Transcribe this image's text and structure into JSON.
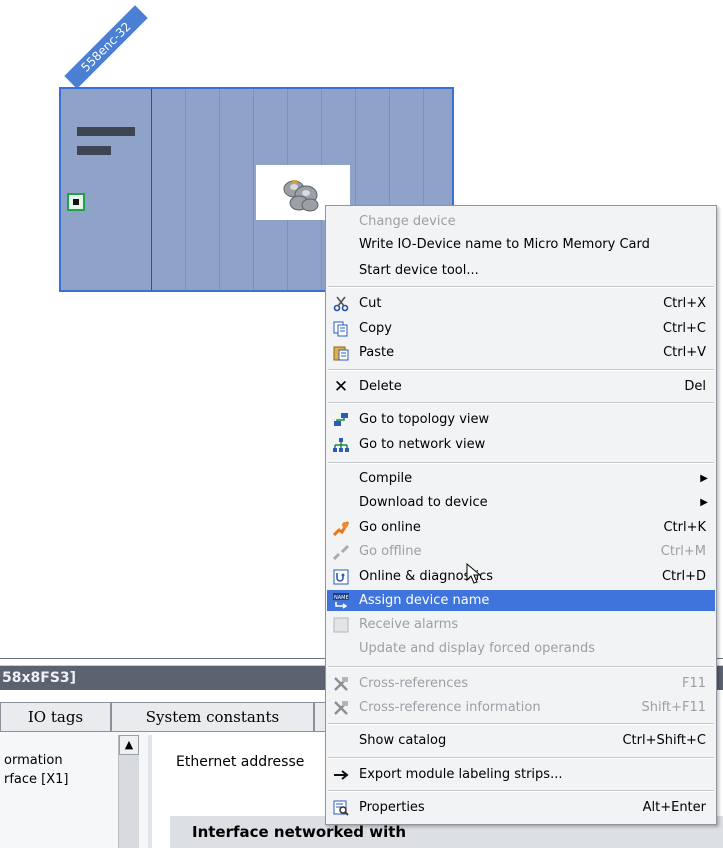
{
  "device": {
    "tag": "558enc-32"
  },
  "bottom_panel": {
    "title": "58x8FS3]",
    "tabs": [
      "IO tags",
      "System constants",
      ""
    ],
    "tree_items": [
      "ormation",
      "rface [X1]"
    ],
    "ethernet_label": "Ethernet addresse",
    "interface_section": "Interface networked with"
  },
  "context_menu": {
    "items": [
      {
        "label": "Change device",
        "shortcut": "",
        "icon": "",
        "disabled": true
      },
      {
        "label": "Write IO-Device name to Micro Memory Card",
        "shortcut": "",
        "icon": "",
        "disabled": false
      },
      {
        "label": "Start device tool...",
        "shortcut": "",
        "icon": "",
        "disabled": false
      },
      {
        "label": "Cut",
        "shortcut": "Ctrl+X",
        "icon": "scissors-icon",
        "disabled": false
      },
      {
        "label": "Copy",
        "shortcut": "Ctrl+C",
        "icon": "copy-icon",
        "disabled": false
      },
      {
        "label": "Paste",
        "shortcut": "Ctrl+V",
        "icon": "paste-icon",
        "disabled": false
      },
      {
        "label": "Delete",
        "shortcut": "Del",
        "icon": "delete-x-icon",
        "disabled": false
      },
      {
        "label": "Go to topology view",
        "shortcut": "",
        "icon": "topology-icon",
        "disabled": false
      },
      {
        "label": "Go to network view",
        "shortcut": "",
        "icon": "network-icon",
        "disabled": false
      },
      {
        "label": "Compile",
        "shortcut": "",
        "icon": "",
        "disabled": false,
        "submenu": true
      },
      {
        "label": "Download to device",
        "shortcut": "",
        "icon": "",
        "disabled": false,
        "submenu": true
      },
      {
        "label": "Go online",
        "shortcut": "Ctrl+K",
        "icon": "go-online-icon",
        "disabled": false
      },
      {
        "label": "Go offline",
        "shortcut": "Ctrl+M",
        "icon": "go-offline-icon",
        "disabled": true
      },
      {
        "label": "Online & diagnostics",
        "shortcut": "Ctrl+D",
        "icon": "diagnostics-icon",
        "disabled": false
      },
      {
        "label": "Assign device name",
        "shortcut": "",
        "icon": "assign-name-icon",
        "disabled": false,
        "highlighted": true
      },
      {
        "label": "Receive alarms",
        "shortcut": "",
        "icon": "receive-alarms-icon",
        "disabled": true
      },
      {
        "label": "Update and display forced operands",
        "shortcut": "",
        "icon": "",
        "disabled": true
      },
      {
        "label": "Cross-references",
        "shortcut": "F11",
        "icon": "cross-references-icon",
        "disabled": true
      },
      {
        "label": "Cross-reference information",
        "shortcut": "Shift+F11",
        "icon": "cross-reference-info-icon",
        "disabled": true
      },
      {
        "label": "Show catalog",
        "shortcut": "Ctrl+Shift+C",
        "icon": "",
        "disabled": false
      },
      {
        "label": "Export module labeling strips...",
        "shortcut": "",
        "icon": "export-icon",
        "disabled": false
      },
      {
        "label": "Properties",
        "shortcut": "Alt+Enter",
        "icon": "properties-icon",
        "disabled": false
      }
    ]
  },
  "colors": {
    "highlight": "#3f74dc",
    "device_body": "#8fa3c8",
    "device_border": "#3a6fd8",
    "panel_title_bg": "#5b6270"
  }
}
